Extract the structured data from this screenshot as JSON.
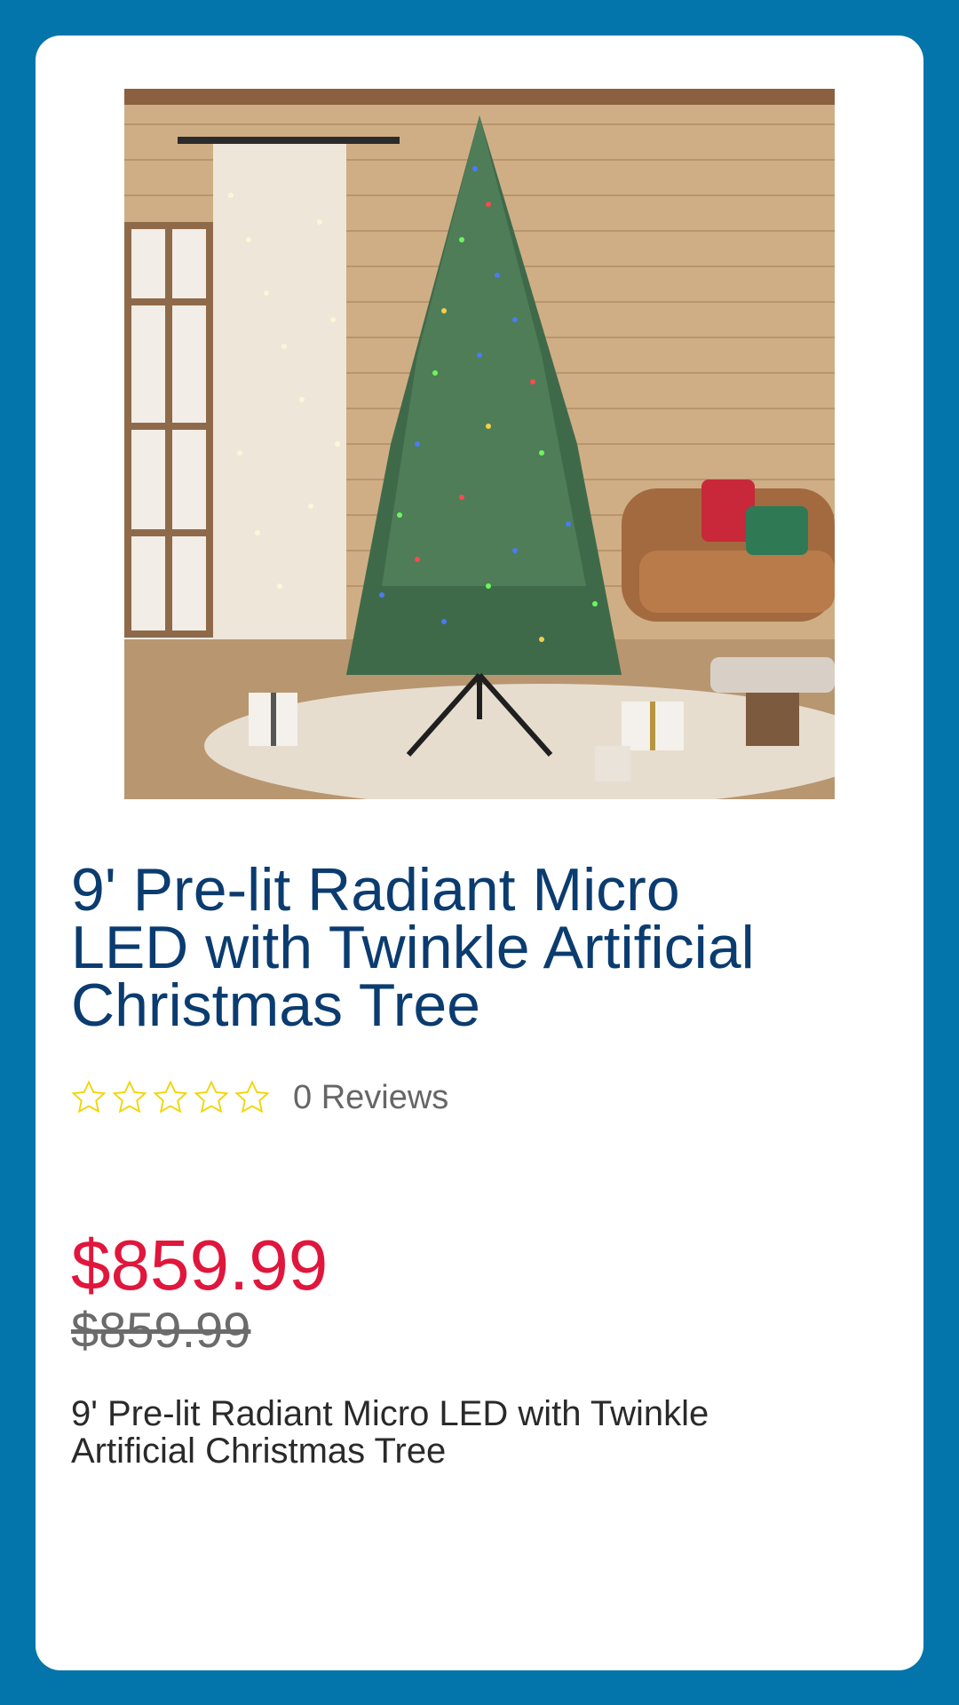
{
  "product": {
    "title": "9' Pre-lit Radiant Micro LED with Twinkle Artificial Christmas Tree",
    "rating": 0,
    "rating_max": 5,
    "reviews_label": "0 Reviews",
    "price": "$859.99",
    "original_price": "$859.99",
    "description": "9' Pre-lit Radiant Micro LED with Twinkle Artificial Christmas Tree",
    "image_icon": "christmas-tree-photo"
  },
  "colors": {
    "background": "#0375ab",
    "card": "#ffffff",
    "title": "#0b3c70",
    "price": "#e0163c",
    "star_outline": "#f2d400",
    "muted_text": "#666666"
  }
}
